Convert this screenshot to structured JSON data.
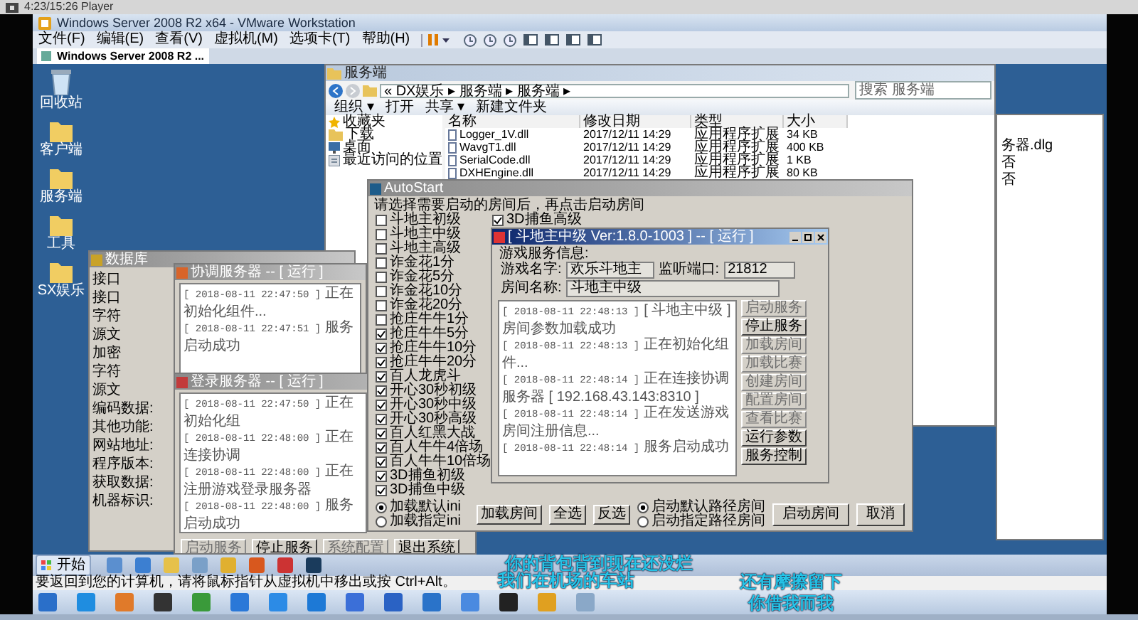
{
  "player": {
    "title": "4:23/15:26 Player"
  },
  "vmware": {
    "title": "Windows Server 2008 R2 x64 - VMware Workstation",
    "menu": [
      "文件(F)",
      "编辑(E)",
      "查看(V)",
      "虚拟机(M)",
      "选项卡(T)",
      "帮助(H)"
    ],
    "tab": "Windows Server 2008 R2 ..."
  },
  "desktop_icons": [
    {
      "label": "回收站",
      "kind": "bin"
    },
    {
      "label": "客户端",
      "kind": "folder"
    },
    {
      "label": "服务端",
      "kind": "folder"
    },
    {
      "label": "工具",
      "kind": "folder"
    },
    {
      "label": "SX娱乐",
      "kind": "folder"
    }
  ],
  "explorer": {
    "title": "服务端",
    "address": "« DX娱乐 ▸ 服务端 ▸ 服务端 ▸",
    "search": {
      "placeholder": "搜索 服务端"
    },
    "toolbar": [
      "组织 ▾",
      "打开",
      "共享 ▾",
      "新建文件夹"
    ],
    "nav": [
      {
        "label": "收藏夹",
        "kind": "star"
      },
      {
        "label": "下载",
        "kind": "folder"
      },
      {
        "label": "桌面",
        "kind": "monitor"
      },
      {
        "label": "最近访问的位置",
        "kind": "recent"
      }
    ],
    "columns": [
      "名称",
      "修改日期",
      "类型",
      "大小"
    ],
    "rows": [
      [
        "Logger_1V.dll",
        "2017/12/11 14:29",
        "应用程序扩展",
        "34 KB"
      ],
      [
        "WavgT1.dll",
        "2017/12/11 14:29",
        "应用程序扩展",
        "400 KB"
      ],
      [
        "SerialCode.dll",
        "2017/12/11 14:29",
        "应用程序扩展",
        "1 KB"
      ],
      [
        "DXHEngine.dll",
        "2017/12/11 14:29",
        "应用程序扩展",
        "80 KB"
      ]
    ]
  },
  "side_panel": {
    "lines": [
      "务器.dlg",
      "否",
      "否"
    ]
  },
  "database_window": {
    "title": "数据库",
    "labels": [
      "接口",
      "接口",
      "字符",
      "源文",
      "加密",
      "字符",
      "源文",
      "编码数据:",
      "其他功能:",
      "网站地址:",
      "程序版本:",
      "获取数据:",
      "机器标识:"
    ]
  },
  "coordinator_window": {
    "title": "协调服务器 -- [ 运行 ]",
    "log": [
      {
        "time": "[ 2018-08-11 22:47:50 ]",
        "text": "正在初始化组件..."
      },
      {
        "time": "[ 2018-08-11 22:47:51 ]",
        "text": "服务启动成功"
      }
    ]
  },
  "login_window": {
    "title": "登录服务器 -- [ 运行 ]",
    "log": [
      {
        "time": "[ 2018-08-11 22:47:50 ]",
        "text": "正在初始化组"
      },
      {
        "time": "[ 2018-08-11 22:48:00 ]",
        "text": "正在连接协调"
      },
      {
        "time": "[ 2018-08-11 22:48:00 ]",
        "text": "正在注册游戏登录服务器"
      },
      {
        "time": "[ 2018-08-11 22:48:00 ]",
        "text": "服务启动成功"
      }
    ],
    "buttons": [
      {
        "label": "启动服务",
        "disabled": true
      },
      {
        "label": "停止服务",
        "disabled": false
      },
      {
        "label": "系统配置",
        "disabled": true
      },
      {
        "label": "退出系统",
        "disabled": false
      }
    ]
  },
  "autostart": {
    "title": "AutoStart",
    "prompt": "请选择需要启动的房间后，再点击启动房间",
    "rooms": [
      {
        "label": "斗地主初级",
        "checked": false
      },
      {
        "label": "斗地主中级",
        "checked": false
      },
      {
        "label": "斗地主高级",
        "checked": false
      },
      {
        "label": "诈金花1分",
        "checked": false
      },
      {
        "label": "诈金花5分",
        "checked": false
      },
      {
        "label": "诈金花10分",
        "checked": false
      },
      {
        "label": "诈金花20分",
        "checked": false
      },
      {
        "label": "抢庄牛牛1分",
        "checked": false
      },
      {
        "label": "抢庄牛牛5分",
        "checked": true
      },
      {
        "label": "抢庄牛牛10分",
        "checked": true
      },
      {
        "label": "抢庄牛牛20分",
        "checked": true
      },
      {
        "label": "百人龙虎斗",
        "checked": true
      },
      {
        "label": "开心30秒初级",
        "checked": true
      },
      {
        "label": "开心30秒中级",
        "checked": true
      },
      {
        "label": "开心30秒高级",
        "checked": true
      },
      {
        "label": "百人红黑大战",
        "checked": true
      },
      {
        "label": "百人牛牛4倍场",
        "checked": true
      },
      {
        "label": "百人牛牛10倍场",
        "checked": true
      },
      {
        "label": "3D捕鱼初级",
        "checked": true
      },
      {
        "label": "3D捕鱼中级",
        "checked": true
      }
    ],
    "column_2": [
      {
        "label": "3D捕鱼高级",
        "checked": true
      }
    ],
    "ini_options": [
      {
        "label": "加载默认ini",
        "selected": true
      },
      {
        "label": "加载指定ini",
        "selected": false
      }
    ],
    "load_buttons": [
      "加载房间",
      "全选",
      "反选"
    ],
    "path_options": [
      {
        "label": "启动默认路径房间",
        "selected": true
      },
      {
        "label": "启动指定路径房间",
        "selected": false
      }
    ],
    "actions": [
      "启动房间",
      "取消"
    ]
  },
  "game_server": {
    "title": "[ 斗地主中级 Ver:1.8.0-1003 ] -- [ 运行 ]",
    "group": "游戏服务信息:",
    "fields": [
      {
        "label": "游戏名字:",
        "value": "欢乐斗地主"
      },
      {
        "label": "监听端口:",
        "value": "21812"
      },
      {
        "label": "房间名称:",
        "value": "斗地主中级"
      }
    ],
    "log": [
      {
        "time": "[ 2018-08-11 22:48:13 ]",
        "text": "[ 斗地主中级 ] 房间参数加载成功"
      },
      {
        "time": "[ 2018-08-11 22:48:13 ]",
        "text": "正在初始化组件..."
      },
      {
        "time": "[ 2018-08-11 22:48:14 ]",
        "text": "正在连接协调服务器 [ 192.168.43.143:8310 ]"
      },
      {
        "time": "[ 2018-08-11 22:48:14 ]",
        "text": "正在发送游戏房间注册信息..."
      },
      {
        "time": "[ 2018-08-11 22:48:14 ]",
        "text": "服务启动成功"
      }
    ],
    "buttons": [
      {
        "label": "启动服务",
        "disabled": true
      },
      {
        "label": "停止服务",
        "disabled": false
      },
      {
        "label": "加载房间",
        "disabled": true
      },
      {
        "label": "加载比赛",
        "disabled": true
      },
      {
        "label": "创建房间",
        "disabled": true
      },
      {
        "label": "配置房间",
        "disabled": true
      },
      {
        "label": "查看比赛",
        "disabled": true
      },
      {
        "label": "运行参数",
        "disabled": false
      },
      {
        "label": "服务控制",
        "disabled": false
      }
    ]
  },
  "vm_taskbar": {
    "start": "开始"
  },
  "status_bar": "要返回到您的计算机，请将鼠标指针从虚拟机中移出或按 Ctrl+Alt。",
  "subtitles": [
    "你的背包背到现在还没烂",
    "我们在机场的车站",
    "还有摩擦留下",
    "你借我而我"
  ]
}
